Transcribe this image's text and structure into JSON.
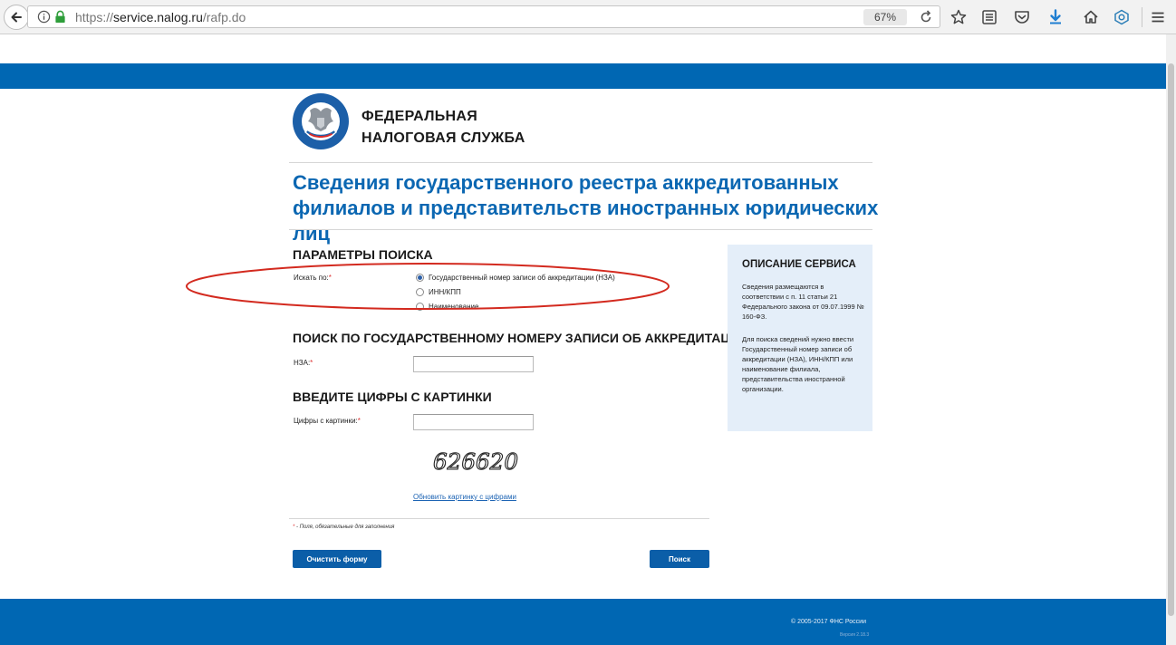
{
  "browser": {
    "url_prefix": "https://",
    "url_host": "service.nalog.ru",
    "url_path": "/rafp.do",
    "zoom": "67%"
  },
  "header": {
    "org_line1": "ФЕДЕРАЛЬНАЯ",
    "org_line2": "НАЛОГОВАЯ СЛУЖБА",
    "title": "Сведения государственного реестра аккредитованных филиалов и представительств иностранных юридических лиц"
  },
  "search_params": {
    "title": "ПАРАМЕТРЫ ПОИСКА",
    "search_by_label": "Искать по:",
    "options": [
      {
        "label": "Государственный номер записи об аккредитации (НЗА)",
        "checked": true
      },
      {
        "label": "ИНН/КПП",
        "checked": false
      },
      {
        "label": "Наименование",
        "checked": false
      }
    ]
  },
  "nza_section": {
    "title": "ПОИСК ПО ГОСУДАРСТВЕННОМУ НОМЕРУ ЗАПИСИ ОБ АККРЕДИТАЦИИ (НЗА)",
    "field_label": "НЗА:",
    "value": ""
  },
  "captcha_section": {
    "title": "ВВЕДИТЕ ЦИФРЫ С КАРТИНКИ",
    "field_label": "Цифры с картинки:",
    "value": "",
    "captcha_text": "626620",
    "refresh_link": "Обновить картинку с цифрами"
  },
  "required_marker": "*",
  "required_hint": " - Поля, обязательные для заполнения",
  "buttons": {
    "clear": "Очистить форму",
    "search": "Поиск"
  },
  "description": {
    "title": "ОПИСАНИЕ СЕРВИСА",
    "p1": "Сведения размещаются в соответствии с п. 11 статьи 21 Федерального закона от 09.07.1999 № 160-ФЗ.",
    "p2": "Для поиска сведений нужно ввести Государственный номер записи об аккредитации (НЗА), ИНН/КПП или наименование филиала, представительства иностранной организации."
  },
  "footer": {
    "copyright": "© 2005-2017 ФНС России",
    "version": "Версия 2.18.3"
  },
  "colors": {
    "brand_blue": "#0067b3",
    "title_blue": "#0b67b2",
    "button_blue": "#0b5ea8",
    "required_red": "#dd3333",
    "annotation_red": "#d32a1f",
    "info_box": "#e4eef9"
  }
}
